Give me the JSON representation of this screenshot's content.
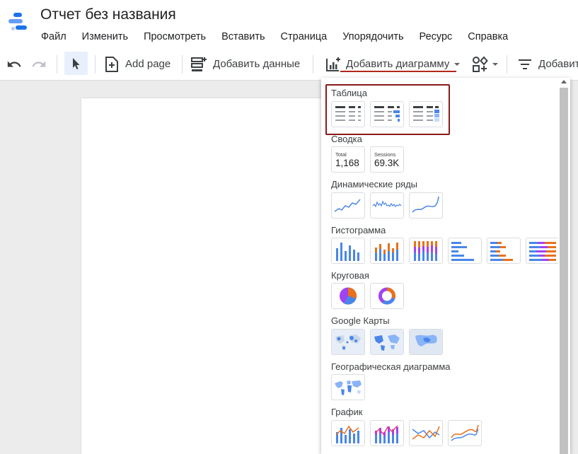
{
  "app": {
    "title": "Отчет без названия",
    "logo": "data-studio-logo"
  },
  "menu": [
    "Файл",
    "Изменить",
    "Просмотреть",
    "Вставить",
    "Страница",
    "Упорядочить",
    "Ресурс",
    "Справка"
  ],
  "toolbar": {
    "undo": "undo-icon",
    "redo": "redo-icon",
    "select": "pointer-icon",
    "add_page_label": "Add page",
    "add_data_label": "Добавить данные",
    "add_chart_label": "Добавить диаграмму",
    "add_control_label": "Добавит"
  },
  "chart_menu": {
    "sections": {
      "table": "Таблица",
      "scorecard": "Сводка",
      "timeseries": "Динамические ряды",
      "bar": "Гистограмма",
      "pie": "Круговая",
      "google_maps": "Google Карты",
      "geo": "Географическая диаграмма",
      "line": "График"
    },
    "scorecards": [
      {
        "label": "Total",
        "value": "1,168"
      },
      {
        "label": "Sessions",
        "value": "69.3K"
      }
    ]
  },
  "colors": {
    "blue": "#4a86e8",
    "orange": "#e8711a",
    "purple": "#a142f4",
    "pink": "#e63b7a",
    "highlight": "#8b1a1a",
    "underline": "#b3261e"
  }
}
